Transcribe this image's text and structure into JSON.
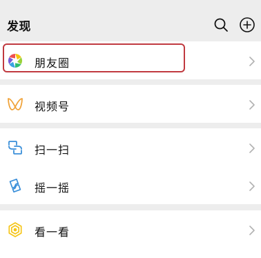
{
  "header": {
    "title": "发现",
    "search_icon": "search-icon",
    "add_icon": "add-circle-icon"
  },
  "sections": [
    {
      "items": [
        {
          "label": "朋友圈",
          "icon": "moments-aperture-icon",
          "highlighted": true
        }
      ]
    },
    {
      "items": [
        {
          "label": "视频号",
          "icon": "channels-butterfly-icon"
        }
      ]
    },
    {
      "items": [
        {
          "label": "扫一扫",
          "icon": "scan-icon"
        },
        {
          "label": "摇一摇",
          "icon": "shake-icon"
        }
      ]
    },
    {
      "items": [
        {
          "label": "看一看",
          "icon": "top-stories-icon"
        }
      ]
    }
  ],
  "colors": {
    "background": "#ededed",
    "row": "#ffffff",
    "highlight_border": "#c0393f",
    "chevron": "#b2b2b2",
    "channels_orange": "#f0a33a",
    "scan_blue": "#3a8fd9",
    "topstories_yellow": "#f5c518"
  }
}
